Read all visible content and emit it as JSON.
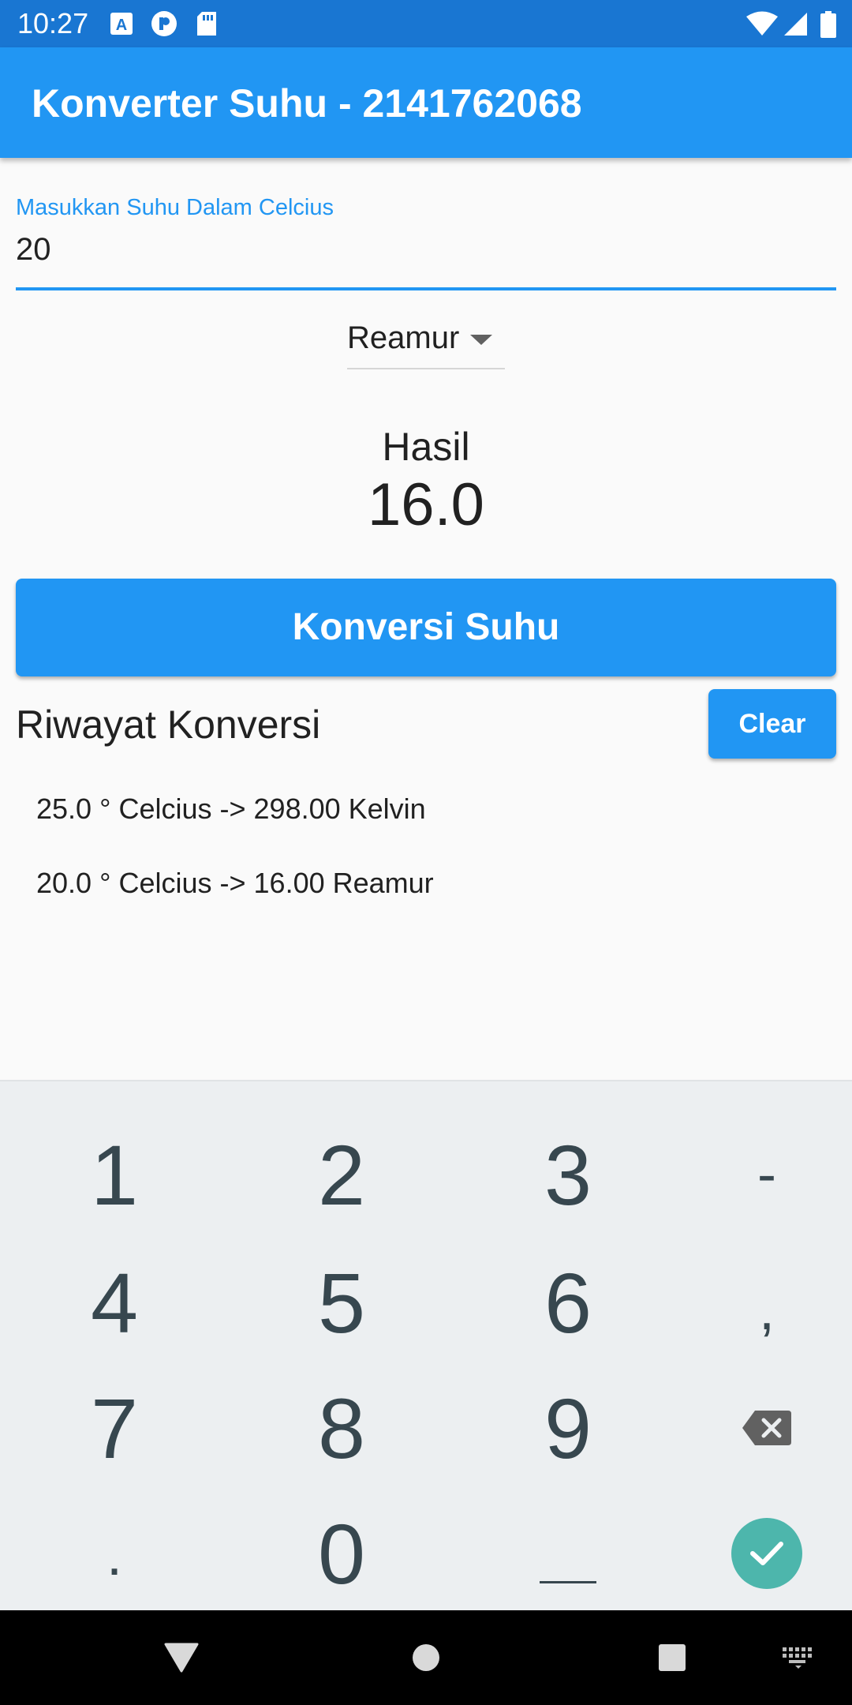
{
  "status_bar": {
    "time": "10:27",
    "icons": [
      "a-notification-icon",
      "p-notification-icon",
      "sd-card-icon",
      "wifi-icon",
      "signal-icon",
      "battery-icon"
    ],
    "background_color": "#1976d2"
  },
  "app_bar": {
    "title": "Konverter Suhu - 2141762068",
    "background_color": "#2196f3"
  },
  "input": {
    "label": "Masukkan Suhu Dalam Celcius",
    "value": "20",
    "accent_color": "#2196f3"
  },
  "dropdown": {
    "selected": "Reamur"
  },
  "result": {
    "label": "Hasil",
    "value": "16.0"
  },
  "convert_button": {
    "label": "Konversi Suhu"
  },
  "history": {
    "title": "Riwayat Konversi",
    "clear_label": "Clear",
    "items": [
      "25.0 ° Celcius -> 298.00 Kelvin",
      "20.0 ° Celcius -> 16.00 Reamur"
    ]
  },
  "keyboard": {
    "keys": [
      [
        "1",
        "2",
        "3",
        "-"
      ],
      [
        "4",
        "5",
        "6",
        ","
      ],
      [
        "7",
        "8",
        "9",
        "backspace-icon"
      ],
      [
        ".",
        "0",
        "space",
        "enter-check-icon"
      ]
    ],
    "enter_color": "#4db6ac"
  },
  "nav_bar": {
    "items": [
      "back-triangle-icon",
      "home-circle-icon",
      "recents-square-icon",
      "keyboard-switch-icon"
    ]
  }
}
